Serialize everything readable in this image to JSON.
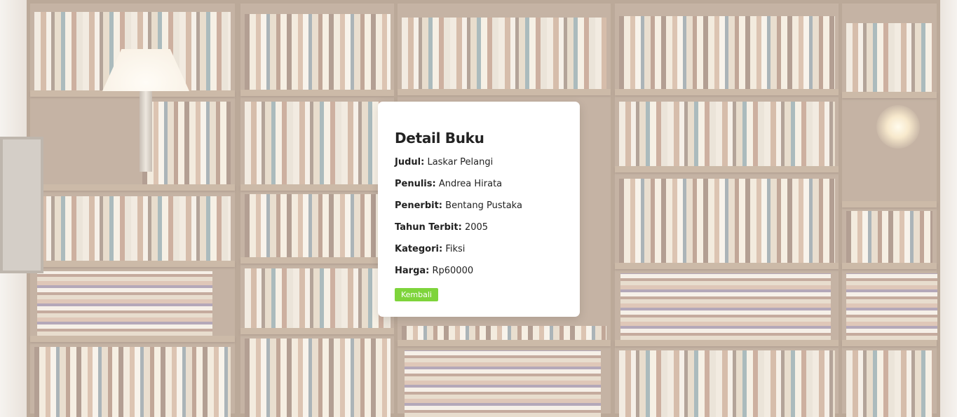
{
  "card": {
    "title": "Detail Buku",
    "fields": [
      {
        "label": "Judul:",
        "value": "Laskar Pelangi"
      },
      {
        "label": "Penulis:",
        "value": "Andrea Hirata"
      },
      {
        "label": "Penerbit:",
        "value": "Bentang Pustaka"
      },
      {
        "label": "Tahun Terbit:",
        "value": "2005"
      },
      {
        "label": "Kategori:",
        "value": "Fiksi"
      },
      {
        "label": "Harga:",
        "value": "Rp60000"
      }
    ],
    "back_button_label": "Kembali",
    "button_color": "#7ed43b"
  },
  "background": {
    "image": "bookshelf-photo"
  }
}
